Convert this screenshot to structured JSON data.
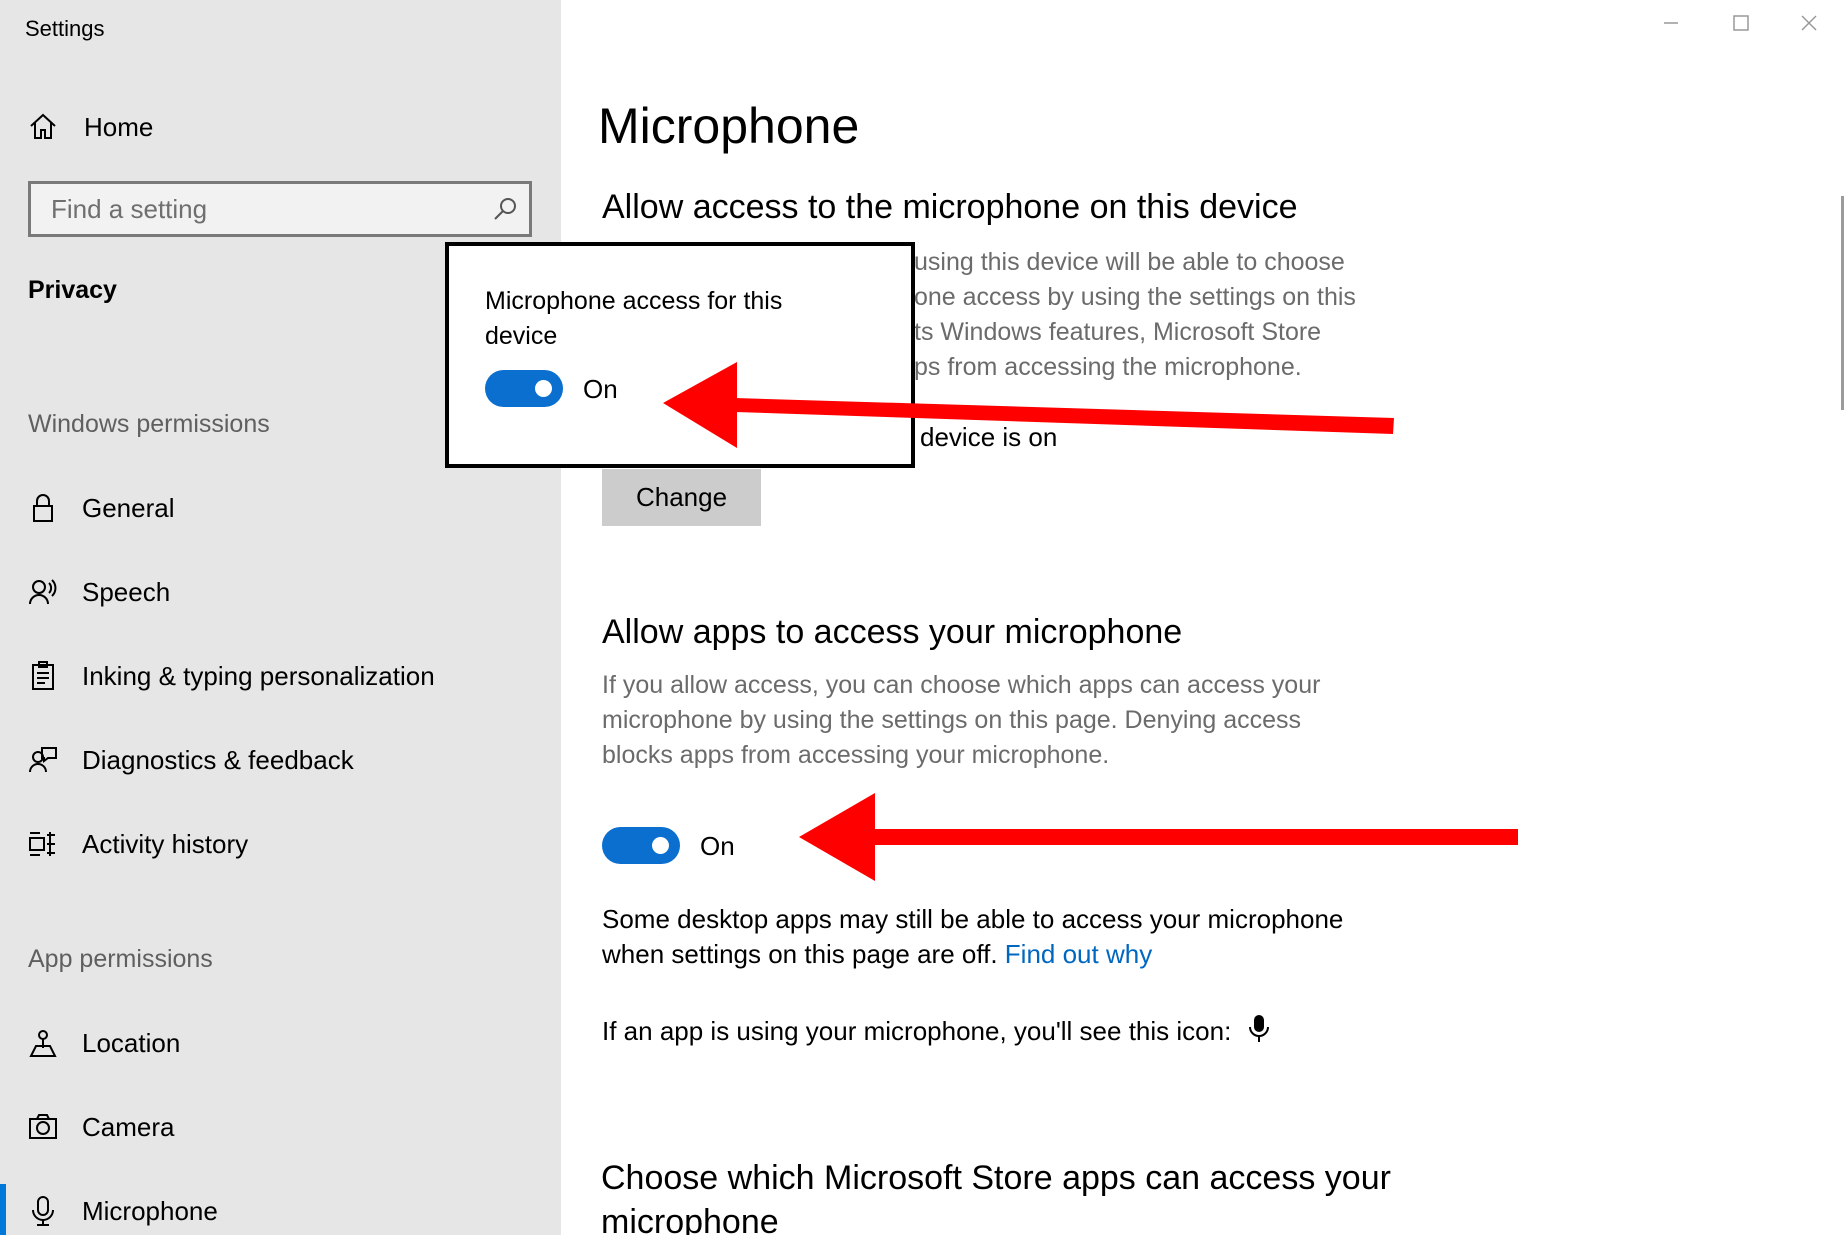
{
  "window": {
    "title": "Settings",
    "controls": [
      "minimize-icon",
      "maximize-icon",
      "close-icon"
    ]
  },
  "sidebar": {
    "home_label": "Home",
    "search_placeholder": "Find a setting",
    "category": "Privacy",
    "windows_permissions_header": "Windows permissions",
    "windows_permissions": [
      {
        "label": "General",
        "icon": "lock-icon"
      },
      {
        "label": "Speech",
        "icon": "speech-icon"
      },
      {
        "label": "Inking & typing personalization",
        "icon": "clipboard-icon"
      },
      {
        "label": "Diagnostics & feedback",
        "icon": "feedback-icon"
      },
      {
        "label": "Activity history",
        "icon": "timeline-icon"
      }
    ],
    "app_permissions_header": "App permissions",
    "app_permissions": [
      {
        "label": "Location",
        "icon": "location-icon"
      },
      {
        "label": "Camera",
        "icon": "camera-icon"
      },
      {
        "label": "Microphone",
        "icon": "microphone-icon",
        "selected": true
      }
    ]
  },
  "main": {
    "page_title": "Microphone",
    "device_section": {
      "title": "Allow access to the microphone on this device",
      "description_visible": "using this device will be able to choose\none access by using the settings on this\nts Windows features, Microsoft Store\nps from accessing the microphone.",
      "status_visible": "device is on",
      "change_button": "Change"
    },
    "apps_section": {
      "title": "Allow apps to access your microphone",
      "description": "If you allow access, you can choose which apps can access your microphone by using the settings on this page. Denying access blocks apps from accessing your microphone.",
      "toggle_state": "On",
      "toggle_on": true
    },
    "desktop_note": "Some desktop apps may still be able to access your microphone when settings on this page are off.",
    "find_out_link": "Find out why",
    "icon_note": "If an app is using your microphone, you'll see this icon:",
    "store_section_title": "Choose which Microsoft Store apps can access your microphone"
  },
  "callout": {
    "title": "Microphone access for this device",
    "toggle_state": "On",
    "toggle_on": true
  },
  "colors": {
    "accent": "#0078d7",
    "toggle_on": "#0b6fcf",
    "link": "#0067c0",
    "sidebar_bg": "#e6e6e6",
    "annotation_arrow": "#ff0000"
  }
}
